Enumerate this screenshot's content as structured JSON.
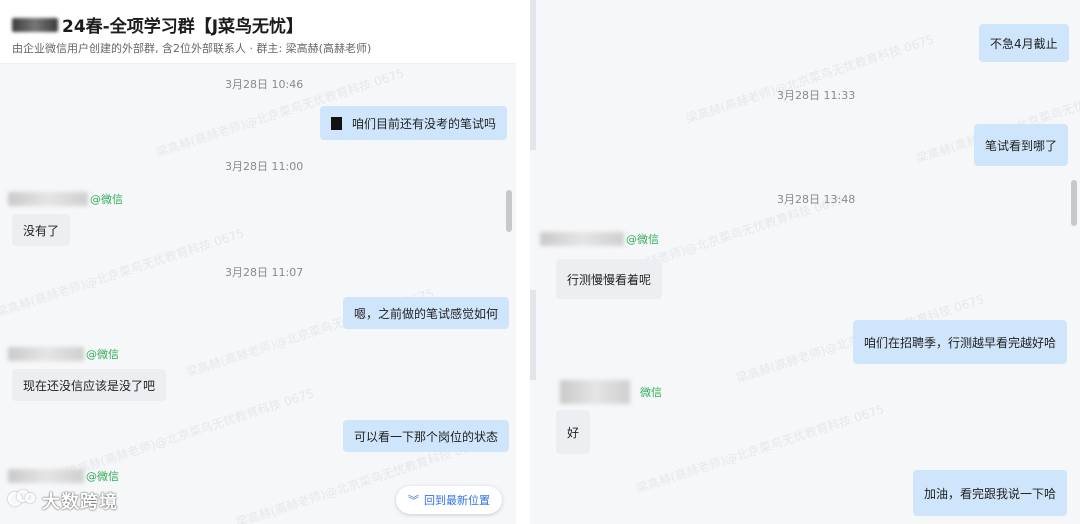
{
  "left": {
    "header": {
      "title": "24春-全项学习群【J菜鸟无忧】",
      "subtitle": "由企业微信用户创建的外部群, 含2位外部联系人 · 群主: 梁高赫(高赫老师)"
    },
    "messages": {
      "t1": "3月28日 10:46",
      "m1": "咱们目前还有没考的笔试吗",
      "t2": "3月28日 11:00",
      "s1_tag": "@微信",
      "m2": "没有了",
      "t3": "3月28日 11:07",
      "m3": "嗯，之前做的笔试感觉如何",
      "s2_tag": "@微信",
      "m4": "现在还没信应该是没了吧",
      "m5": "可以看一下那个岗位的状态",
      "s3_tag": "@微信"
    },
    "back_button": "回到最新位置",
    "logo_text": "大数跨境"
  },
  "right": {
    "messages": {
      "m1": "不急4月截止",
      "t1": "3月28日 11:33",
      "m2": "笔试看到哪了",
      "t2": "3月28日 13:48",
      "s1_tag": "@微信",
      "m3": "行测慢慢看着呢",
      "m4": "咱们在招聘季，行测越早看完越好哈",
      "s2_tag": "微信",
      "m5": "好",
      "m6": "加油，看完跟我说一下哈"
    }
  },
  "watermark": "梁高赫(高赫老师)@北京菜鸟无忧教育科技 0675",
  "colors": {
    "outgoing_bubble": "#cfe5fb",
    "incoming_bubble": "#eceef1",
    "wechat_tag": "#2eae57",
    "link_blue": "#2f74e2"
  },
  "icons": [
    "double-chevron-down-icon",
    "brand-logo-icon"
  ]
}
